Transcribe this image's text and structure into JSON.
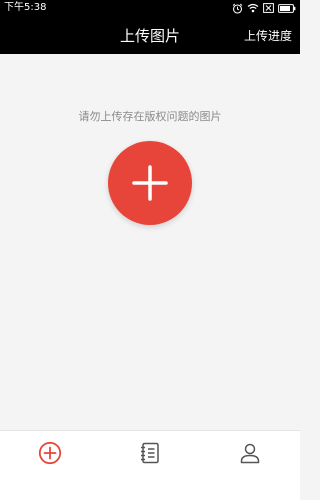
{
  "status_bar": {
    "time": "下午5:38",
    "icons": [
      "alarm-icon",
      "wifi-icon",
      "notification-off-icon",
      "battery-icon"
    ]
  },
  "header": {
    "title": "上传图片",
    "action_label": "上传进度"
  },
  "main": {
    "notice": "请勿上传存在版权问题的图片",
    "add_button": {
      "icon": "plus-icon",
      "color": "#e8453a"
    }
  },
  "bottom_nav": {
    "items": [
      {
        "icon": "add-circle-icon",
        "active": true,
        "color": "#e8453a"
      },
      {
        "icon": "notebook-icon",
        "active": false,
        "color": "#555555"
      },
      {
        "icon": "user-icon",
        "active": false,
        "color": "#555555"
      }
    ]
  }
}
